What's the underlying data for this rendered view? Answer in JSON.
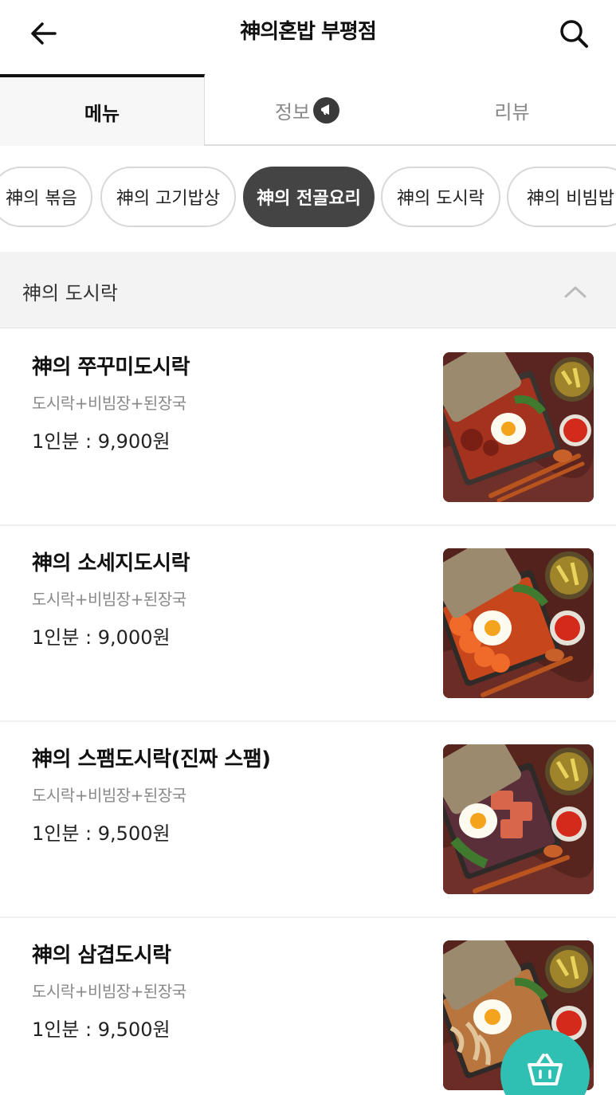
{
  "header": {
    "title": "神의혼밥 부평점",
    "back_icon": "arrow-left-icon",
    "search_icon": "search-icon"
  },
  "tabs": [
    {
      "label": "메뉴",
      "active": true
    },
    {
      "label": "정보",
      "active": false,
      "icon": "megaphone-icon"
    },
    {
      "label": "리뷰",
      "active": false
    }
  ],
  "categories": [
    {
      "label": "神의 볶음",
      "active": false
    },
    {
      "label": "神의 고기밥상",
      "active": false
    },
    {
      "label": "神의 전골요리",
      "active": true
    },
    {
      "label": "神의 도시락",
      "active": false
    },
    {
      "label": "神의 비빔밥",
      "active": false
    }
  ],
  "section": {
    "title": "神의 도시락",
    "toggle_icon": "chevron-up-icon"
  },
  "menu_items": [
    {
      "name": "神의 쭈꾸미도시락",
      "description": "도시락+비빔장+된장국",
      "price": "1인분 : 9,900원"
    },
    {
      "name": "神의 소세지도시락",
      "description": "도시락+비빔장+된장국",
      "price": "1인분 : 9,000원"
    },
    {
      "name": "神의 스팸도시락(진짜 스팸)",
      "description": "도시락+비빔장+된장국",
      "price": "1인분 : 9,500원"
    },
    {
      "name": "神의 삼겹도시락",
      "description": "도시락+비빔장+된장국",
      "price": "1인분 : 9,500원"
    }
  ],
  "cart": {
    "icon": "basket-icon",
    "color": "#2fbfb3"
  },
  "colors": {
    "active_chip": "#444444",
    "accent": "#2fbfb3"
  }
}
